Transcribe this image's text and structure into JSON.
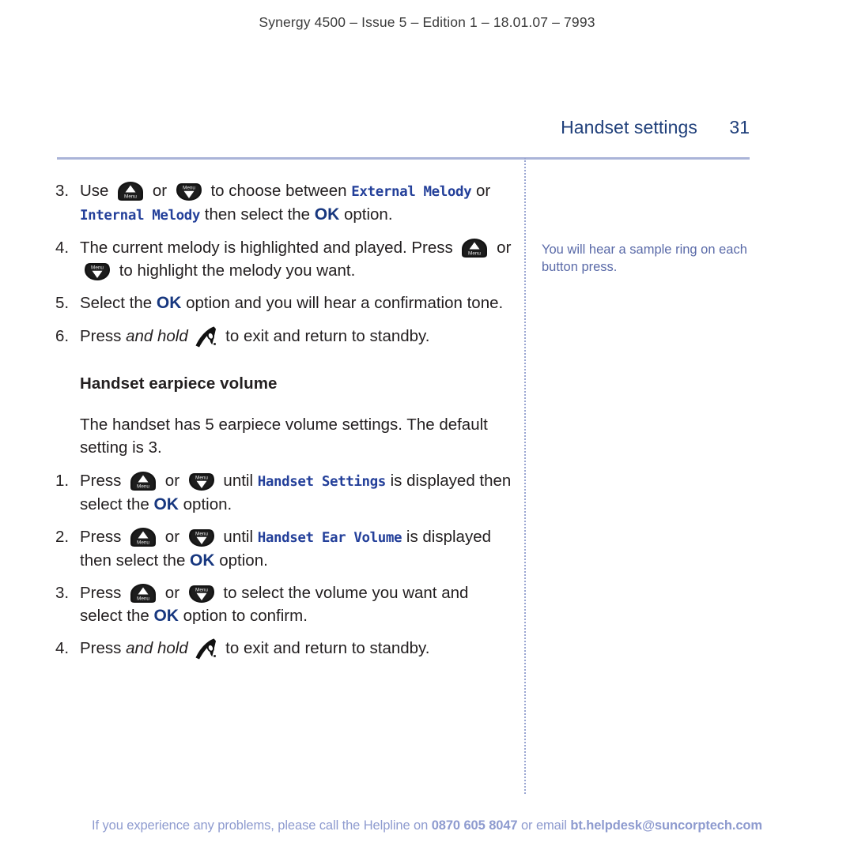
{
  "running_head": "Synergy 4500 – Issue 5 –  Edition 1 – 18.01.07 – 7993",
  "header": {
    "section_title": "Handset settings",
    "page_number": "31"
  },
  "colors": {
    "section_title": "#1f3f7a",
    "rule": "#aab4d8",
    "divider": "#9aa6d2",
    "lcd_text": "#24409a",
    "ok_accent": "#17377f",
    "side_note": "#5a6aa8",
    "footer": "#8e9bcf",
    "body_text": "#231f20"
  },
  "icons": {
    "up_key": "menu-up-key-icon",
    "down_key": "menu-down-key-icon",
    "phone": "hangup-phone-icon",
    "key_label": "Menu"
  },
  "steps_top": [
    {
      "num": "3.",
      "parts": [
        {
          "t": "text",
          "v": "Use "
        },
        {
          "t": "key-up"
        },
        {
          "t": "text",
          "v": " or "
        },
        {
          "t": "key-down"
        },
        {
          "t": "text",
          "v": " to choose between "
        },
        {
          "t": "lcd",
          "v": "External Melody"
        },
        {
          "t": "text",
          "v": " or "
        },
        {
          "t": "lcd",
          "v": "Internal Melody"
        },
        {
          "t": "text",
          "v": " then select the "
        },
        {
          "t": "ok",
          "v": "OK"
        },
        {
          "t": "text",
          "v": " option."
        }
      ]
    },
    {
      "num": "4.",
      "parts": [
        {
          "t": "text",
          "v": "The current melody is highlighted and played. Press "
        },
        {
          "t": "key-up"
        },
        {
          "t": "text",
          "v": " or "
        },
        {
          "t": "key-down"
        },
        {
          "t": "text",
          "v": " to highlight the melody you want."
        }
      ]
    },
    {
      "num": "5.",
      "parts": [
        {
          "t": "text",
          "v": "Select the "
        },
        {
          "t": "ok",
          "v": "OK"
        },
        {
          "t": "text",
          "v": " option and you will hear a confirmation tone."
        }
      ]
    },
    {
      "num": "6.",
      "parts": [
        {
          "t": "text",
          "v": "Press "
        },
        {
          "t": "ital",
          "v": "and hold"
        },
        {
          "t": "text",
          "v": " "
        },
        {
          "t": "phone"
        },
        {
          "t": "text",
          "v": " to exit and return to standby."
        }
      ]
    }
  ],
  "section": {
    "heading": "Handset earpiece volume",
    "intro": "The handset has 5 earpiece volume settings. The default setting is 3.",
    "steps": [
      {
        "num": "1.",
        "parts": [
          {
            "t": "text",
            "v": "Press "
          },
          {
            "t": "key-up"
          },
          {
            "t": "text",
            "v": " or "
          },
          {
            "t": "key-down"
          },
          {
            "t": "text",
            "v": " until "
          },
          {
            "t": "lcd",
            "v": "Handset Settings"
          },
          {
            "t": "text",
            "v": " is displayed then select the "
          },
          {
            "t": "ok",
            "v": "OK"
          },
          {
            "t": "text",
            "v": " option."
          }
        ]
      },
      {
        "num": "2.",
        "parts": [
          {
            "t": "text",
            "v": "Press "
          },
          {
            "t": "key-up"
          },
          {
            "t": "text",
            "v": " or "
          },
          {
            "t": "key-down"
          },
          {
            "t": "text",
            "v": " until "
          },
          {
            "t": "lcd",
            "v": "Handset Ear Volume"
          },
          {
            "t": "text",
            "v": " is displayed then select the "
          },
          {
            "t": "ok",
            "v": "OK"
          },
          {
            "t": "text",
            "v": " option."
          }
        ]
      },
      {
        "num": "3.",
        "parts": [
          {
            "t": "text",
            "v": "Press "
          },
          {
            "t": "key-up"
          },
          {
            "t": "text",
            "v": " or "
          },
          {
            "t": "key-down"
          },
          {
            "t": "text",
            "v": " to select the volume you want and select the "
          },
          {
            "t": "ok",
            "v": "OK"
          },
          {
            "t": "text",
            "v": " option to confirm."
          }
        ]
      },
      {
        "num": "4.",
        "parts": [
          {
            "t": "text",
            "v": "Press "
          },
          {
            "t": "ital",
            "v": "and hold"
          },
          {
            "t": "text",
            "v": " "
          },
          {
            "t": "phone"
          },
          {
            "t": "text",
            "v": " to exit and return to standby."
          }
        ]
      }
    ]
  },
  "side_note": "You will hear a sample ring on each button press.",
  "footer": {
    "lead": "If you experience any problems, please call the Helpline on ",
    "phone": "0870 605 8047",
    "mid": " or email ",
    "email": "bt.helpdesk@suncorptech.com"
  }
}
